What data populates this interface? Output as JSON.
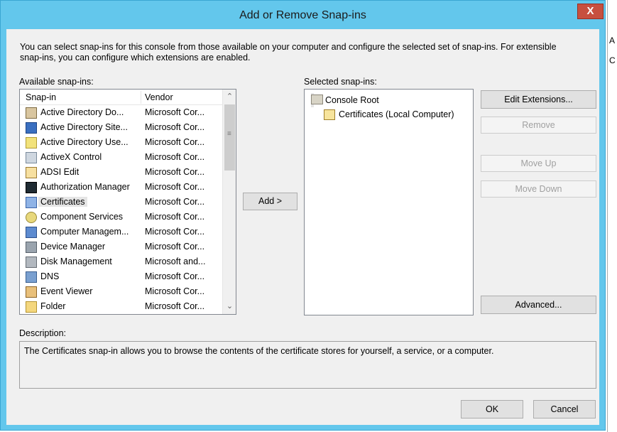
{
  "window": {
    "title": "Add or Remove Snap-ins",
    "close_glyph": "X"
  },
  "intro": "You can select snap-ins for this console from those available on your computer and configure the selected set of snap-ins. For extensible snap-ins, you can configure which extensions are enabled.",
  "available": {
    "label": "Available snap-ins:",
    "col_snapin": "Snap-in",
    "col_vendor": "Vendor",
    "items": [
      {
        "name": "Active Directory Do...",
        "vendor": "Microsoft Cor...",
        "icon": "active-directory-domains-icon"
      },
      {
        "name": "Active Directory Site...",
        "vendor": "Microsoft Cor...",
        "icon": "active-directory-sites-icon"
      },
      {
        "name": "Active Directory Use...",
        "vendor": "Microsoft Cor...",
        "icon": "active-directory-users-icon"
      },
      {
        "name": "ActiveX Control",
        "vendor": "Microsoft Cor...",
        "icon": "activex-control-icon"
      },
      {
        "name": "ADSI Edit",
        "vendor": "Microsoft Cor...",
        "icon": "adsi-edit-icon"
      },
      {
        "name": "Authorization Manager",
        "vendor": "Microsoft Cor...",
        "icon": "authorization-manager-icon"
      },
      {
        "name": "Certificates",
        "vendor": "Microsoft Cor...",
        "icon": "certificates-icon"
      },
      {
        "name": "Component Services",
        "vendor": "Microsoft Cor...",
        "icon": "component-services-icon"
      },
      {
        "name": "Computer Managem...",
        "vendor": "Microsoft Cor...",
        "icon": "computer-management-icon"
      },
      {
        "name": "Device Manager",
        "vendor": "Microsoft Cor...",
        "icon": "device-manager-icon"
      },
      {
        "name": "Disk Management",
        "vendor": "Microsoft and...",
        "icon": "disk-management-icon"
      },
      {
        "name": "DNS",
        "vendor": "Microsoft Cor...",
        "icon": "dns-icon"
      },
      {
        "name": "Event Viewer",
        "vendor": "Microsoft Cor...",
        "icon": "event-viewer-icon"
      },
      {
        "name": "Folder",
        "vendor": "Microsoft Cor...",
        "icon": "folder-icon"
      }
    ],
    "selected_item": "Certificates"
  },
  "add_button": "Add >",
  "selected": {
    "label": "Selected snap-ins:",
    "root": "Console Root",
    "child": "Certificates (Local Computer)"
  },
  "buttons": {
    "edit_extensions": "Edit Extensions...",
    "remove": "Remove",
    "move_up": "Move Up",
    "move_down": "Move Down",
    "advanced": "Advanced...",
    "ok": "OK",
    "cancel": "Cancel"
  },
  "description": {
    "label": "Description:",
    "text": "The Certificates snap-in allows you to browse the contents of the certificate stores for yourself, a service, or a computer."
  },
  "background_window": {
    "chars": [
      "A",
      "C"
    ]
  }
}
